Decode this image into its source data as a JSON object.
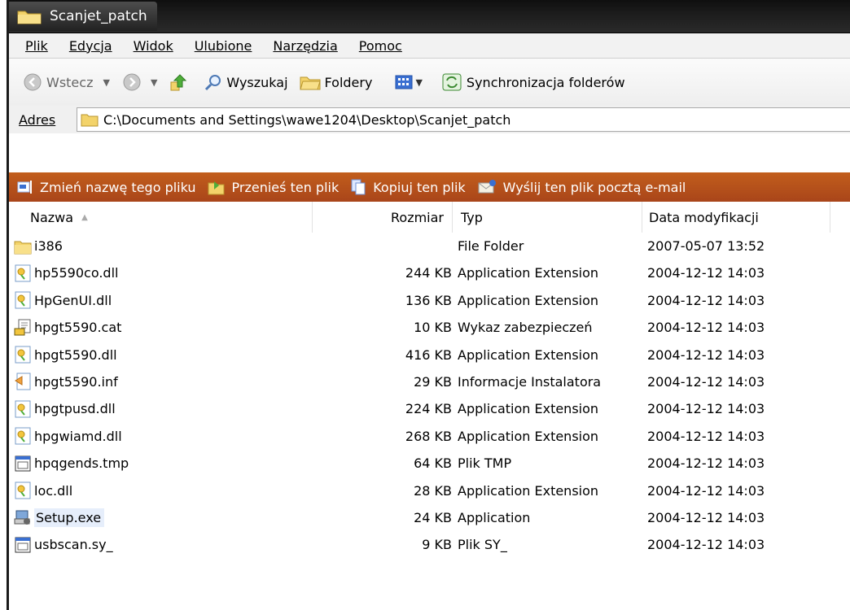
{
  "window": {
    "title": "Scanjet_patch"
  },
  "menu": [
    "Plik",
    "Edycja",
    "Widok",
    "Ulubione",
    "Narzędzia",
    "Pomoc"
  ],
  "toolbar": {
    "back": "Wstecz",
    "search": "Wyszukaj",
    "folders": "Foldery",
    "sync": "Synchronizacja folderów"
  },
  "address": {
    "label": "Adres",
    "path": "C:\\Documents and Settings\\wawe1204\\Desktop\\Scanjet_patch"
  },
  "tasks": [
    {
      "icon": "rename-icon",
      "label": "Zmień nazwę tego pliku"
    },
    {
      "icon": "move-icon",
      "label": "Przenieś ten plik"
    },
    {
      "icon": "copy-icon",
      "label": "Kopiuj ten plik"
    },
    {
      "icon": "email-icon",
      "label": "Wyślij ten plik pocztą e-mail"
    }
  ],
  "columns": {
    "name": "Nazwa",
    "size": "Rozmiar",
    "type": "Typ",
    "date": "Data modyfikacji"
  },
  "files": [
    {
      "icon": "folder-icon",
      "name": "i386",
      "size": "",
      "type": "File Folder",
      "date": "2007-05-07 13:52"
    },
    {
      "icon": "dll-icon",
      "name": "hp5590co.dll",
      "size": "244 KB",
      "type": "Application Extension",
      "date": "2004-12-12 14:03"
    },
    {
      "icon": "dll-icon",
      "name": "HpGenUI.dll",
      "size": "136 KB",
      "type": "Application Extension",
      "date": "2004-12-12 14:03"
    },
    {
      "icon": "catalog-icon",
      "name": "hpgt5590.cat",
      "size": "10 KB",
      "type": "Wykaz zabezpieczeń",
      "date": "2004-12-12 14:03"
    },
    {
      "icon": "dll-icon",
      "name": "hpgt5590.dll",
      "size": "416 KB",
      "type": "Application Extension",
      "date": "2004-12-12 14:03"
    },
    {
      "icon": "inf-icon",
      "name": "hpgt5590.inf",
      "size": "29 KB",
      "type": "Informacje Instalatora",
      "date": "2004-12-12 14:03"
    },
    {
      "icon": "dll-icon",
      "name": "hpgtpusd.dll",
      "size": "224 KB",
      "type": "Application Extension",
      "date": "2004-12-12 14:03"
    },
    {
      "icon": "dll-icon",
      "name": "hpgwiamd.dll",
      "size": "268 KB",
      "type": "Application Extension",
      "date": "2004-12-12 14:03"
    },
    {
      "icon": "generic-file-icon",
      "name": "hpqgends.tmp",
      "size": "64 KB",
      "type": "Plik TMP",
      "date": "2004-12-12 14:03"
    },
    {
      "icon": "dll-icon",
      "name": "loc.dll",
      "size": "28 KB",
      "type": "Application Extension",
      "date": "2004-12-12 14:03"
    },
    {
      "icon": "setup-icon",
      "name": "Setup.exe",
      "size": "24 KB",
      "type": "Application",
      "date": "2004-12-12 14:03",
      "selected": true
    },
    {
      "icon": "generic-file-icon",
      "name": "usbscan.sy_",
      "size": "9 KB",
      "type": "Plik SY_",
      "date": "2004-12-12 14:03"
    }
  ],
  "colors": {
    "taskbar": "#b54f1b",
    "title": "#1c1c1c",
    "selection": "#e6eefb"
  }
}
